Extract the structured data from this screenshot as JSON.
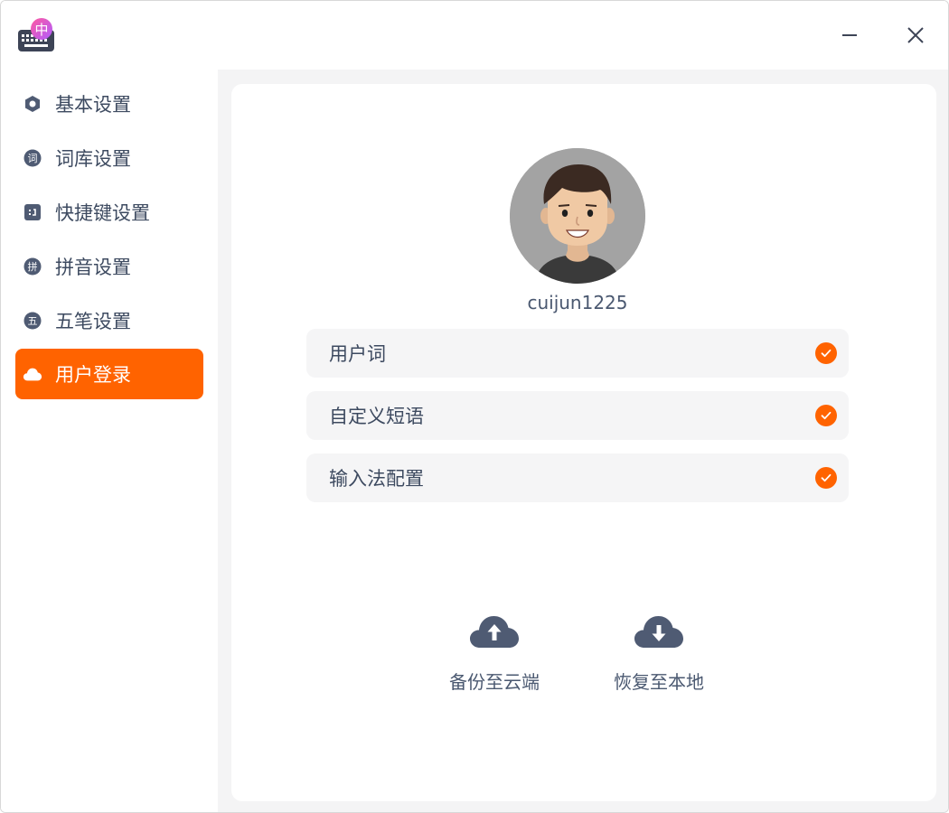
{
  "app": {
    "icon": "keyboard-ime-icon",
    "icon_badge_text": "中"
  },
  "window_controls": {
    "minimize_icon": "minimize-icon",
    "close_icon": "close-icon"
  },
  "sidebar": {
    "items": [
      {
        "label": "基本设置",
        "icon": "hexagon-icon",
        "icon_text": ""
      },
      {
        "label": "词库设置",
        "icon": "dictionary-icon",
        "icon_text": "词"
      },
      {
        "label": "快捷键设置",
        "icon": "shortcut-icon",
        "icon_text": ""
      },
      {
        "label": "拼音设置",
        "icon": "pinyin-icon",
        "icon_text": "拼"
      },
      {
        "label": "五笔设置",
        "icon": "wubi-icon",
        "icon_text": "五"
      },
      {
        "label": "用户登录",
        "icon": "cloud-icon",
        "icon_text": "",
        "active": true
      }
    ]
  },
  "user": {
    "username": "cuijun1225",
    "avatar": "avatar-icon"
  },
  "sync_options": [
    {
      "label": "用户词",
      "checked": true
    },
    {
      "label": "自定义短语",
      "checked": true
    },
    {
      "label": "输入法配置",
      "checked": true
    }
  ],
  "actions": {
    "backup_label": "备份至云端",
    "backup_icon": "cloud-upload-icon",
    "restore_label": "恢复至本地",
    "restore_icon": "cloud-download-icon"
  },
  "colors": {
    "accent": "#ff6300",
    "text": "#3d4a60",
    "icon": "#4f5b73"
  }
}
